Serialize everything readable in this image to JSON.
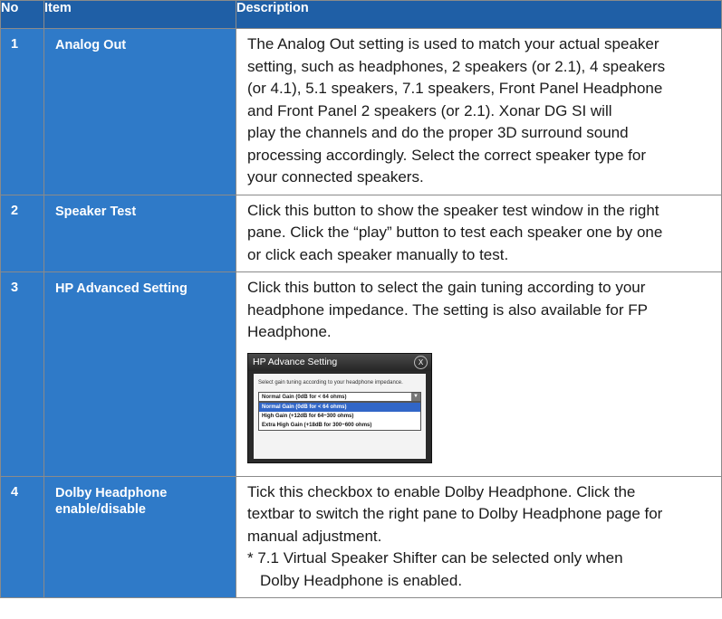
{
  "header": {
    "no": "No",
    "item": "Item",
    "description": "Description"
  },
  "rows": [
    {
      "no": "1",
      "item": "Analog Out",
      "desc": [
        "The Analog Out setting is used to match your actual speaker",
        "setting, such as headphones, 2 speakers (or 2.1), 4 speakers",
        "(or 4.1), 5.1 speakers, 7.1 speakers, Front Panel Headphone",
        "and Front Panel 2 speakers (or 2.1). Xonar DG SI will",
        "play the channels and do the proper 3D surround sound",
        "processing accordingly. Select the correct speaker type for",
        "your connected speakers."
      ]
    },
    {
      "no": "2",
      "item": "Speaker Test",
      "desc": [
        "Click this button to show the speaker test window in the right",
        "pane. Click the “play” button to test each speaker one by one",
        "or click each speaker manually to test."
      ]
    },
    {
      "no": "3",
      "item": "HP Advanced Setting",
      "desc": [
        "Click this button to select the gain tuning according to your",
        "headphone impedance. The setting is also available for FP",
        "Headphone."
      ],
      "dialog": {
        "title": "HP Advance Setting",
        "close": "X",
        "hint": "Select gain tuning according to your headphone impedance.",
        "selected": "Normal Gain (0dB for < 64 ohms)",
        "options": [
          "Normal Gain (0dB for < 64 ohms)",
          "High Gain (+12dB for 64~300 ohms)",
          "Extra High Gain (+18dB for 300~600 ohms)"
        ]
      }
    },
    {
      "no": "4",
      "item": "Dolby Headphone enable/disable",
      "desc": [
        "Tick this checkbox to enable Dolby Headphone. Click the",
        "textbar to switch the right pane to Dolby Headphone page for",
        "manual adjustment."
      ],
      "note": [
        "* 7.1 Virtual Speaker Shifter can be selected only when",
        "Dolby Headphone is enabled."
      ]
    }
  ]
}
